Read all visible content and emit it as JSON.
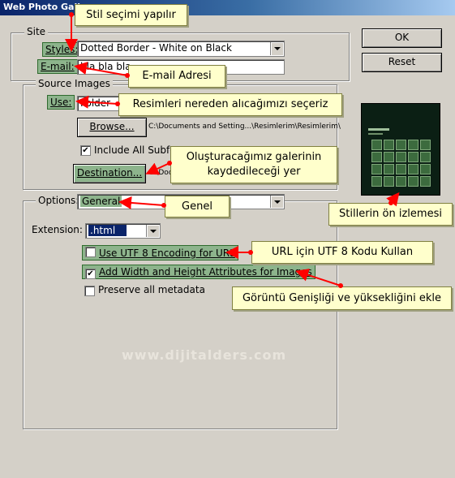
{
  "window": {
    "title": "Web Photo Gall"
  },
  "site": {
    "legend": "Site",
    "styles_label": "Styles:",
    "styles_value": "Dotted Border - White on Black",
    "email_label": "E-mail:",
    "email_value": "bla bla bla"
  },
  "source": {
    "legend": "Source Images",
    "use_label": "Use:",
    "use_value": "Folder",
    "browse_label": "Browse...",
    "browse_path": "C:\\Documents and Setting...\\Resimlerim\\Resimlerim\\",
    "include_subfolders": "Include All Subfo",
    "destination_label": "Destination...",
    "destination_path": "C:\\Doc"
  },
  "options": {
    "legend": "Options:",
    "value": "General",
    "extension_label": "Extension:",
    "extension_value": ".html",
    "utf8_label": "Use UTF 8 Encoding for URL",
    "utf8_checked": false,
    "width_height_label": "Add Width and Height Attributes for Images",
    "width_height_checked": true,
    "preserve_label": "Preserve all metadata",
    "preserve_checked": false
  },
  "buttons": {
    "ok": "OK",
    "reset": "Reset"
  },
  "callouts": {
    "style": "Stil seçimi yapılır",
    "email": "E-mail Adresi",
    "source": "Resimleri nereden alıcağımızı seçeriz",
    "destination_line1": "Oluşturacağımız galerinin",
    "destination_line2": "kaydedileceği yer",
    "general": "Genel",
    "preview": "Stillerin ön izlemesi",
    "utf8": "URL için UTF 8 Kodu Kullan",
    "dimensions": "Görüntü Genişliği ve yüksekliğini ekle"
  },
  "watermark": "www.dijitalders.com",
  "colors": {
    "callout_bg": "#ffffcc",
    "label_highlight": "#8db48c",
    "arrow": "#ff0000",
    "dialog_bg": "#d4d0c8"
  }
}
